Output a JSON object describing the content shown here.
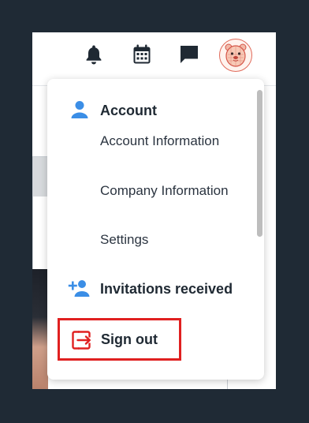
{
  "header": {
    "icons": [
      "bell-icon",
      "calendar-icon",
      "chat-icon"
    ],
    "avatar": "bear-avatar-icon"
  },
  "menu": {
    "account": {
      "icon": "person-icon",
      "label": "Account",
      "items": [
        {
          "label": "Account Information"
        },
        {
          "label": "Company Information"
        },
        {
          "label": "Settings"
        }
      ]
    },
    "invitations": {
      "icon": "person-add-icon",
      "label": "Invitations received"
    },
    "signout": {
      "icon": "sign-out-icon",
      "label": "Sign out"
    }
  },
  "colors": {
    "backdrop": "#1f2a35",
    "icon_blue": "#3b8ee6",
    "signout_red": "#e02020",
    "highlight_border": "#e02020",
    "text_dark": "#1f2933"
  }
}
